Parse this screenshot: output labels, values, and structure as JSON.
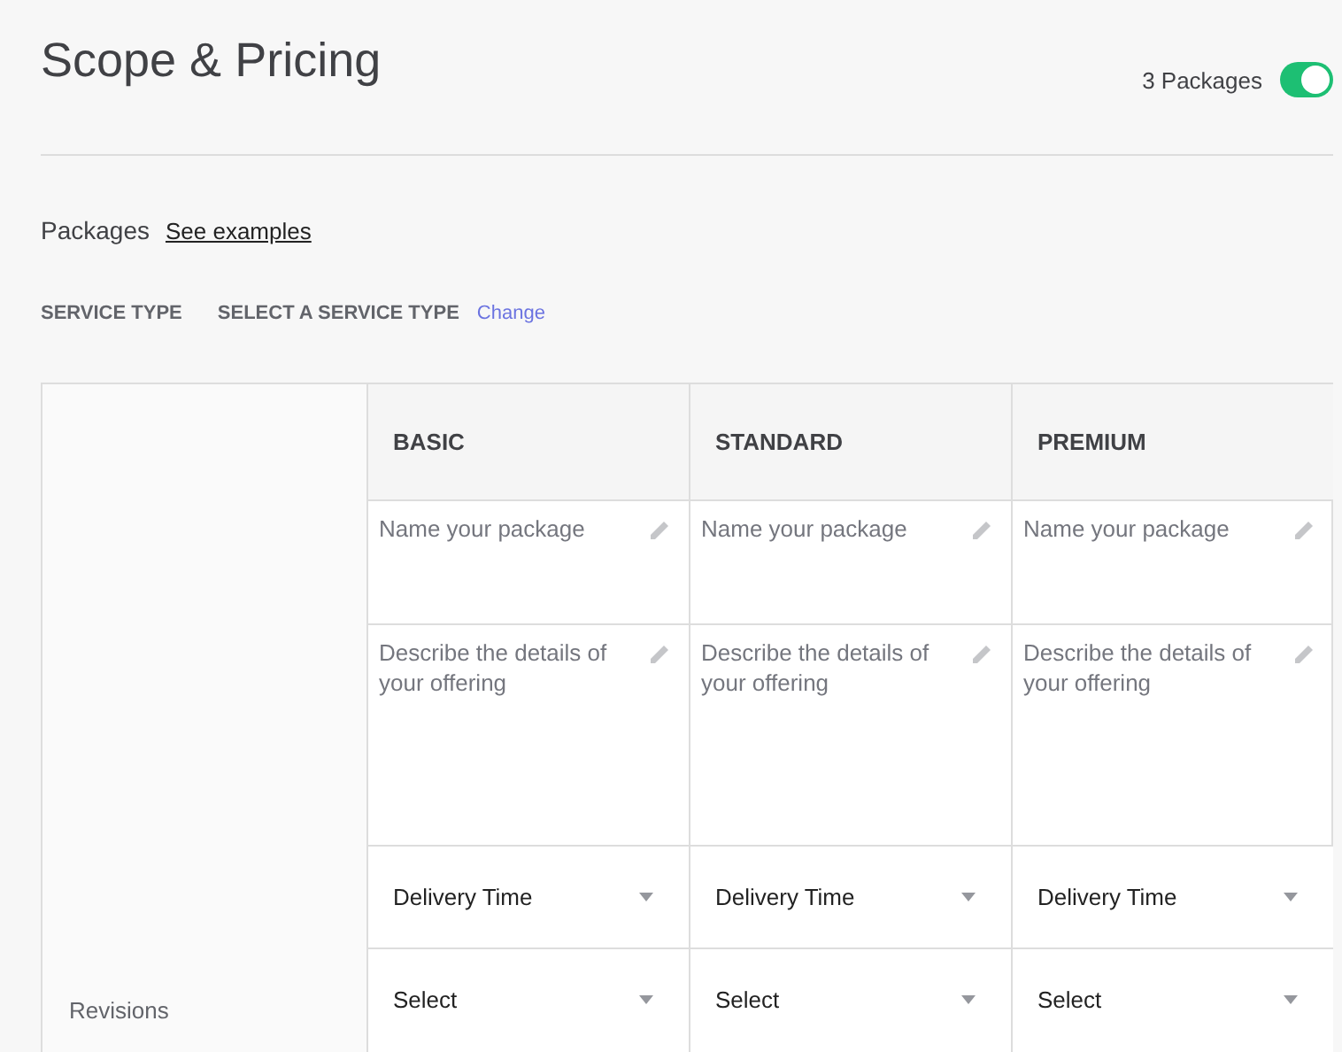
{
  "header": {
    "title": "Scope & Pricing",
    "packages_toggle": {
      "label": "3 Packages",
      "on": true
    }
  },
  "packages": {
    "heading": "Packages",
    "link": "See examples"
  },
  "service_type": {
    "label": "SERVICE TYPE",
    "value": "SELECT A SERVICE TYPE",
    "action": "Change"
  },
  "table": {
    "revisions_label": "Revisions",
    "columns": [
      {
        "name": "BASIC",
        "name_placeholder": "Name your package",
        "description_placeholder": "Describe the details of your offering",
        "delivery_time": "Delivery Time",
        "revisions": "Select"
      },
      {
        "name": "STANDARD",
        "name_placeholder": "Name your package",
        "description_placeholder": "Describe the details of your offering",
        "delivery_time": "Delivery Time",
        "revisions": "Select"
      },
      {
        "name": "PREMIUM",
        "name_placeholder": "Name your package",
        "description_placeholder": "Describe the details of your offering",
        "delivery_time": "Delivery Time",
        "revisions": "Select"
      }
    ]
  }
}
